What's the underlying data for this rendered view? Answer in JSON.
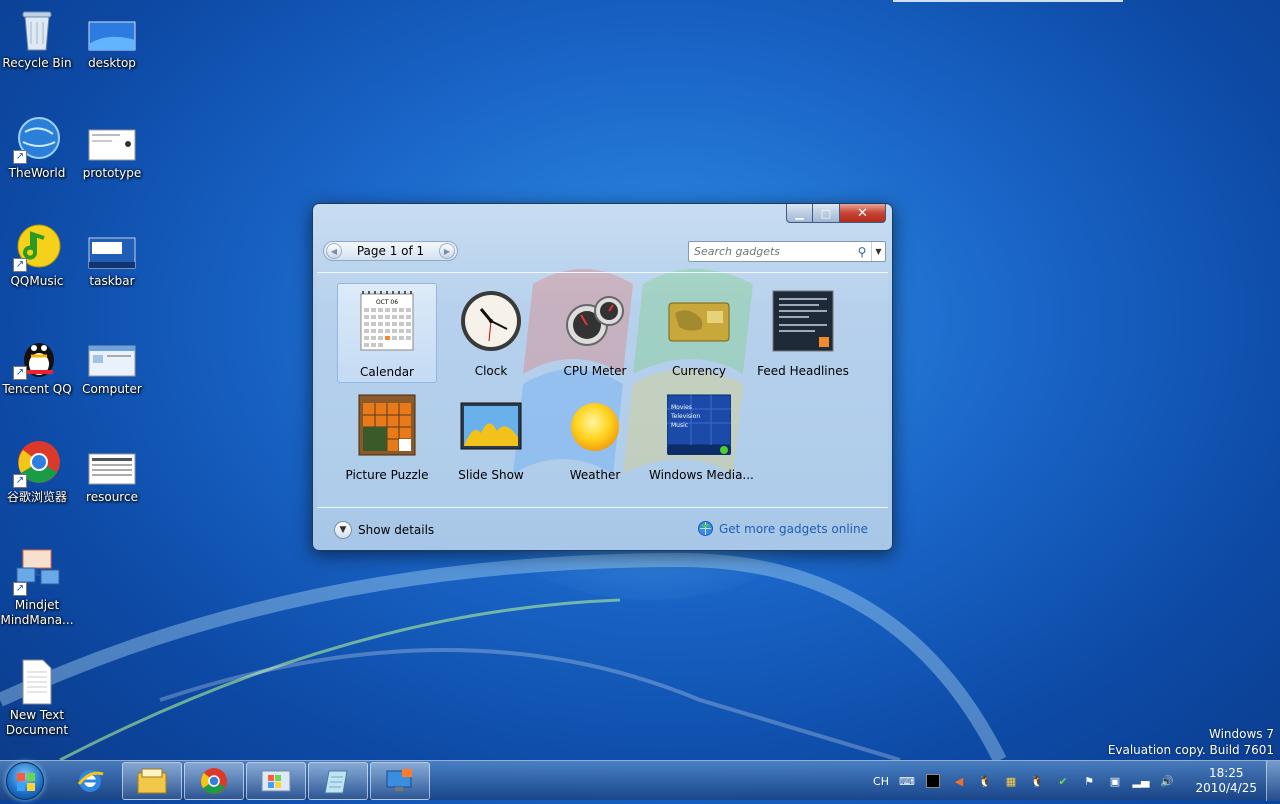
{
  "desktop": {
    "icons": [
      {
        "label": "Recycle Bin",
        "icon": "recycle-bin-icon"
      },
      {
        "label": "desktop",
        "icon": "desktop-folder-icon"
      },
      {
        "label": "TheWorld",
        "icon": "theworld-browser-icon"
      },
      {
        "label": "prototype",
        "icon": "prototype-file-icon"
      },
      {
        "label": "QQMusic",
        "icon": "qqmusic-icon"
      },
      {
        "label": "taskbar",
        "icon": "taskbar-file-icon"
      },
      {
        "label": "Tencent QQ",
        "icon": "tencent-qq-icon"
      },
      {
        "label": "Computer",
        "icon": "computer-file-icon"
      },
      {
        "label": "谷歌浏览器",
        "icon": "chrome-icon"
      },
      {
        "label": "resource",
        "icon": "resource-file-icon"
      },
      {
        "label": "Mindjet MindMana...",
        "icon": "mindjet-icon"
      },
      {
        "label": "New Text Document",
        "icon": "text-document-icon"
      }
    ]
  },
  "gadget_window": {
    "pager": {
      "label": "Page 1 of 1"
    },
    "search": {
      "placeholder": "Search gadgets"
    },
    "gadgets": [
      {
        "label": "Calendar",
        "icon": "calendar-gadget-icon",
        "selected": true,
        "calendar_month": "OCT 06"
      },
      {
        "label": "Clock",
        "icon": "clock-gadget-icon"
      },
      {
        "label": "CPU Meter",
        "icon": "cpu-meter-gadget-icon"
      },
      {
        "label": "Currency",
        "icon": "currency-gadget-icon"
      },
      {
        "label": "Feed Headlines",
        "icon": "feed-headlines-gadget-icon"
      },
      {
        "label": "Picture Puzzle",
        "icon": "picture-puzzle-gadget-icon"
      },
      {
        "label": "Slide Show",
        "icon": "slide-show-gadget-icon"
      },
      {
        "label": "Weather",
        "icon": "weather-gadget-icon"
      },
      {
        "label": "Windows Media...",
        "icon": "windows-media-center-gadget-icon",
        "menu": [
          "Movies",
          "Television",
          "Music"
        ]
      }
    ],
    "footer": {
      "details_label": "Show details",
      "more_link": "Get more gadgets online"
    }
  },
  "watermark": {
    "line1": "Windows 7",
    "line2": "Evaluation copy. Build 7601"
  },
  "taskbar": {
    "pinned": [
      "internet-explorer-icon",
      "windows-explorer-icon",
      "chrome-icon",
      "control-panel-icon",
      "notepad-icon",
      "remote-desktop-icon"
    ],
    "tray": {
      "language": "CH",
      "time": "18:25",
      "date": "2010/4/25"
    }
  },
  "colors": {
    "desktop_blue": "#1a66c8",
    "link_blue": "#1f5eb4",
    "close_red": "#c74433"
  }
}
